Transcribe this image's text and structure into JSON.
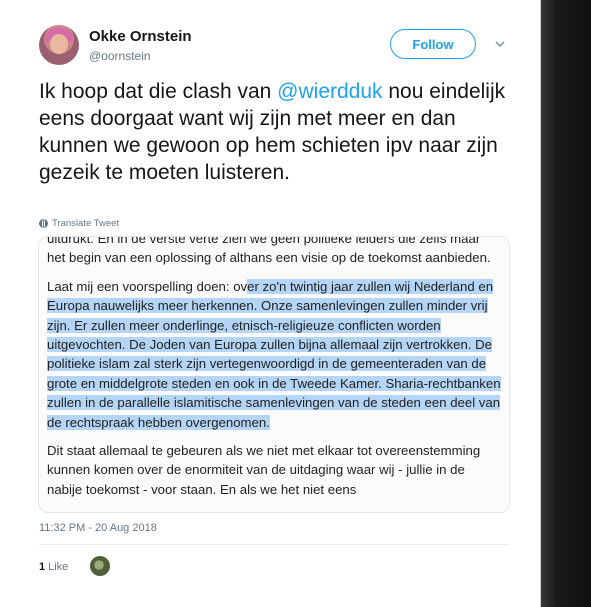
{
  "user": {
    "name": "Okke Ornstein",
    "handle": "@oornstein"
  },
  "follow_label": "Follow",
  "tweet": {
    "text_before": "Ik hoop dat die clash van ",
    "mention": "@wierdduk",
    "text_after": " nou eindelijk eens doorgaat want wij zijn met meer en dan kunnen we gewoon op hem schieten ipv naar zijn gezeik te moeten luisteren."
  },
  "translate_label": "Translate Tweet",
  "media": {
    "para1": "uitdrukt. En in de verste verte zien we geen politieke leiders die zelfs maar het begin van een oplossing of althans een visie op de toekomst aanbieden.",
    "para2_plain": "Laat mij een voorspelling doen: ov",
    "para2_highlight": "er zo'n twintig jaar zullen wij Nederland en Europa nauwelijks meer herkennen. Onze samenlevingen zullen minder vrij zijn. Er zullen meer onderlinge, etnisch-religieuze conflicten worden uitgevochten. De Joden van Europa zullen bijna allemaal zijn vertrokken. De politieke islam zal sterk zijn vertegenwoordigd in de gemeenteraden van de grote en middelgrote steden en ook in de Tweede Kamer. Sharia-rechtbanken zullen in de parallelle islamitische samenlevingen van de steden een deel van de rechtspraak hebben overgenomen.",
    "para3": "Dit staat allemaal te gebeuren als we niet met elkaar tot overeenstemming kunnen komen over de enormiteit van de uitdaging waar wij - jullie in de nabije toekomst - voor staan. En als we het niet eens"
  },
  "timestamp": "11:32 PM - 20 Aug 2018",
  "likes": {
    "count": "1",
    "label": "Like"
  }
}
